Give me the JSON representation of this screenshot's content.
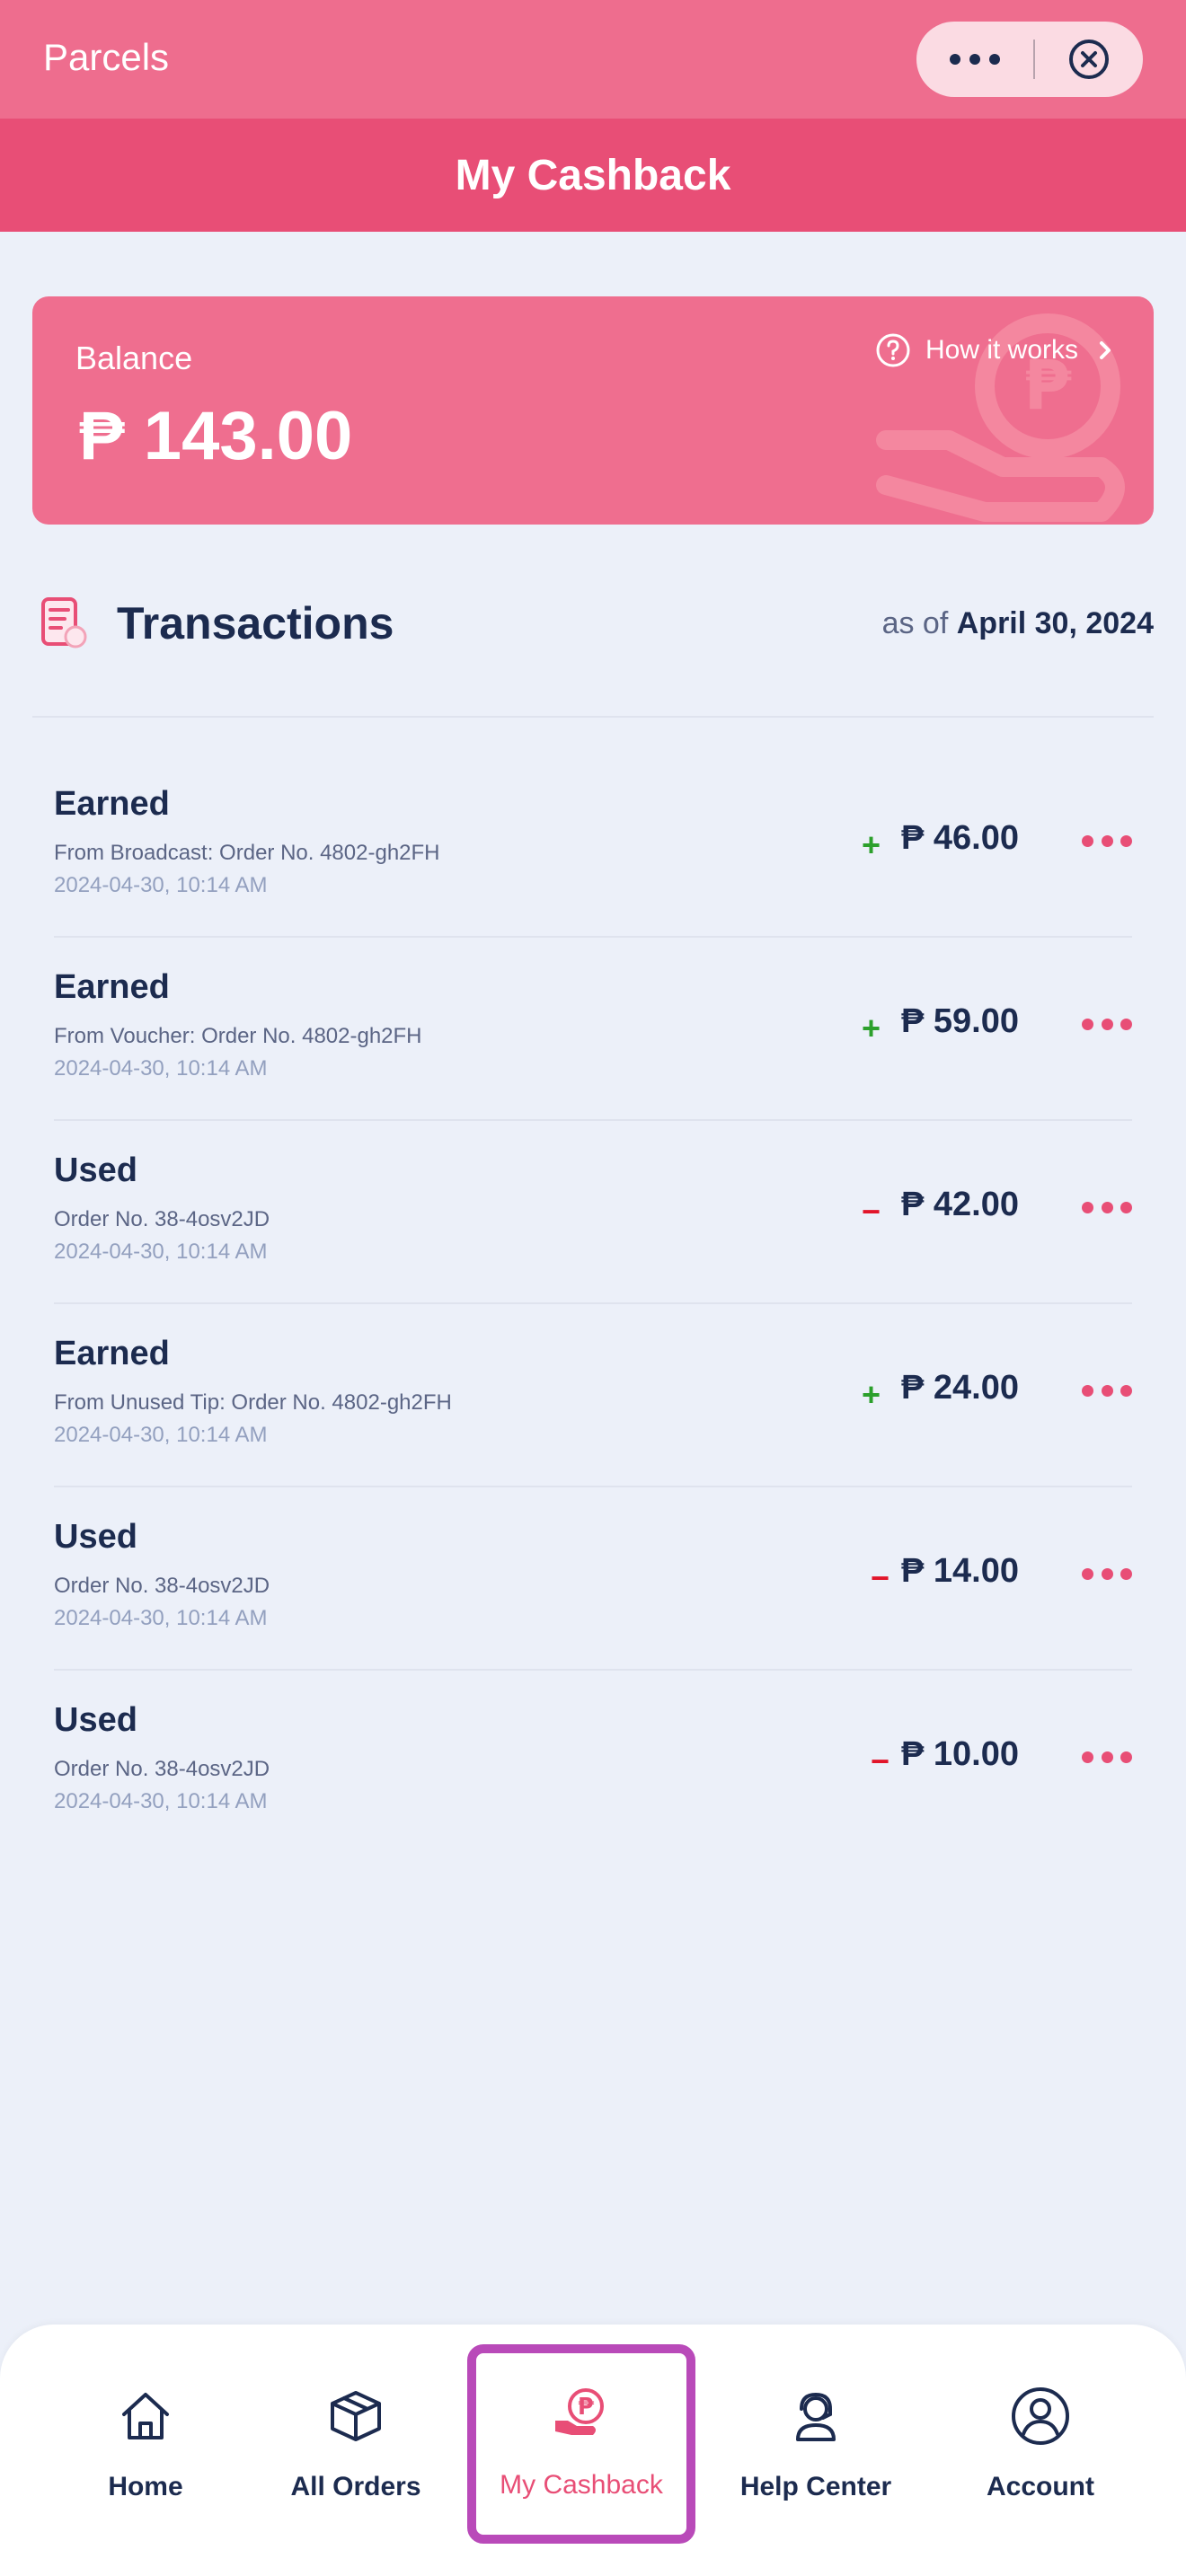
{
  "header": {
    "app_name": "Parcels",
    "page_title": "My Cashback"
  },
  "balance": {
    "label": "Balance",
    "amount": "₱ 143.00",
    "how_it_works": "How it works"
  },
  "transactions": {
    "title": "Transactions",
    "as_of_prefix": "as of",
    "as_of_date": "April 30, 2024",
    "items": [
      {
        "type": "Earned",
        "desc": "From Broadcast: Order No. 4802-gh2FH",
        "date": "2024-04-30, 10:14 AM",
        "sign": "+",
        "amount": "₱ 46.00"
      },
      {
        "type": "Earned",
        "desc": "From Voucher: Order No. 4802-gh2FH",
        "date": "2024-04-30, 10:14 AM",
        "sign": "+",
        "amount": "₱ 59.00"
      },
      {
        "type": "Used",
        "desc": "Order No. 38-4osv2JD",
        "date": "2024-04-30, 10:14 AM",
        "sign": "−",
        "amount": "₱ 42.00"
      },
      {
        "type": "Earned",
        "desc": "From Unused Tip: Order No. 4802-gh2FH",
        "date": "2024-04-30, 10:14 AM",
        "sign": "+",
        "amount": "₱ 24.00"
      },
      {
        "type": "Used",
        "desc": "Order No. 38-4osv2JD",
        "date": "2024-04-30, 10:14 AM",
        "sign": "−",
        "amount": "₱ 14.00"
      },
      {
        "type": "Used",
        "desc": "Order No. 38-4osv2JD",
        "date": "2024-04-30, 10:14 AM",
        "sign": "−",
        "amount": "₱ 10.00"
      }
    ]
  },
  "nav": {
    "items": [
      {
        "label": "Home",
        "icon": "home-icon"
      },
      {
        "label": "All Orders",
        "icon": "box-icon"
      },
      {
        "label": "My Cashback",
        "icon": "cashback-icon",
        "active": true
      },
      {
        "label": "Help Center",
        "icon": "headset-icon"
      },
      {
        "label": "Account",
        "icon": "user-icon"
      }
    ]
  },
  "colors": {
    "topbar": "#ee6d8e",
    "titlebar": "#e84e76",
    "accent": "#e84e76",
    "earned_sign": "#2ca02c",
    "used_sign": "#e2152a",
    "text_dark": "#1c2b4f",
    "active_outline": "#b94ab9"
  }
}
